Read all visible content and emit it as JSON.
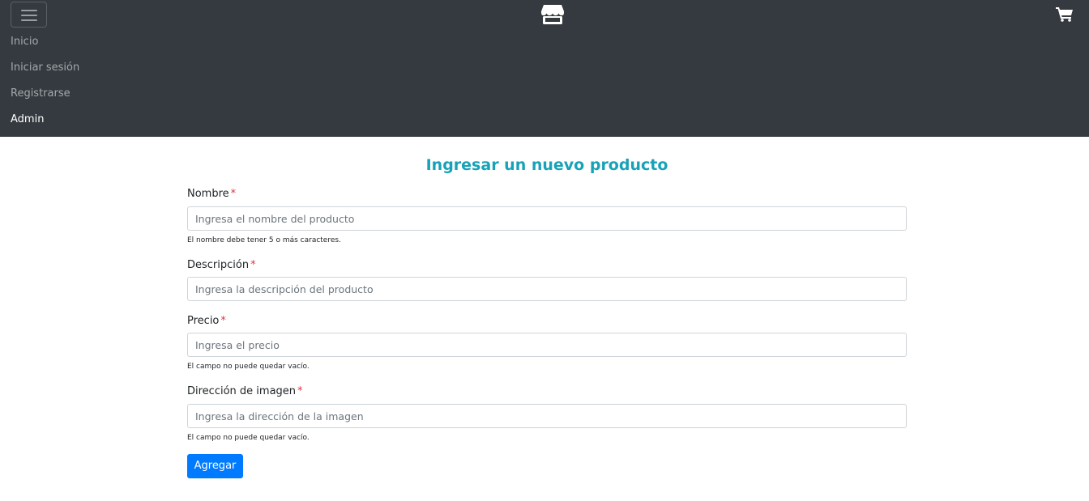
{
  "navbar": {
    "toggler_icon": "hamburger-menu-icon",
    "brand_icon": "store-icon",
    "cart_icon": "shopping-cart-icon",
    "links": [
      {
        "label": "Inicio"
      },
      {
        "label": "Iniciar sesión"
      },
      {
        "label": "Registrarse"
      },
      {
        "label": "Admin"
      }
    ],
    "background_color": "#343a40"
  },
  "form": {
    "title": "Ingresar un nuevo producto",
    "title_color": "#17a2b8",
    "required_marker": "*",
    "fields": [
      {
        "label": "Nombre",
        "placeholder": "Ingresa el nombre del producto",
        "value": "",
        "help": "El nombre debe tener 5 o más caracteres."
      },
      {
        "label": "Descripción",
        "placeholder": "Ingresa la descripción del producto",
        "value": ""
      },
      {
        "label": "Precio",
        "placeholder": "Ingresa el precio",
        "value": "",
        "help": "El campo no puede quedar vacío."
      },
      {
        "label": "Dirección de imagen",
        "placeholder": "Ingresa la dirección de la imagen",
        "value": "",
        "help": "El campo no puede quedar vacío."
      }
    ],
    "submit_label": "Agregar",
    "submit_color": "#007bff"
  }
}
